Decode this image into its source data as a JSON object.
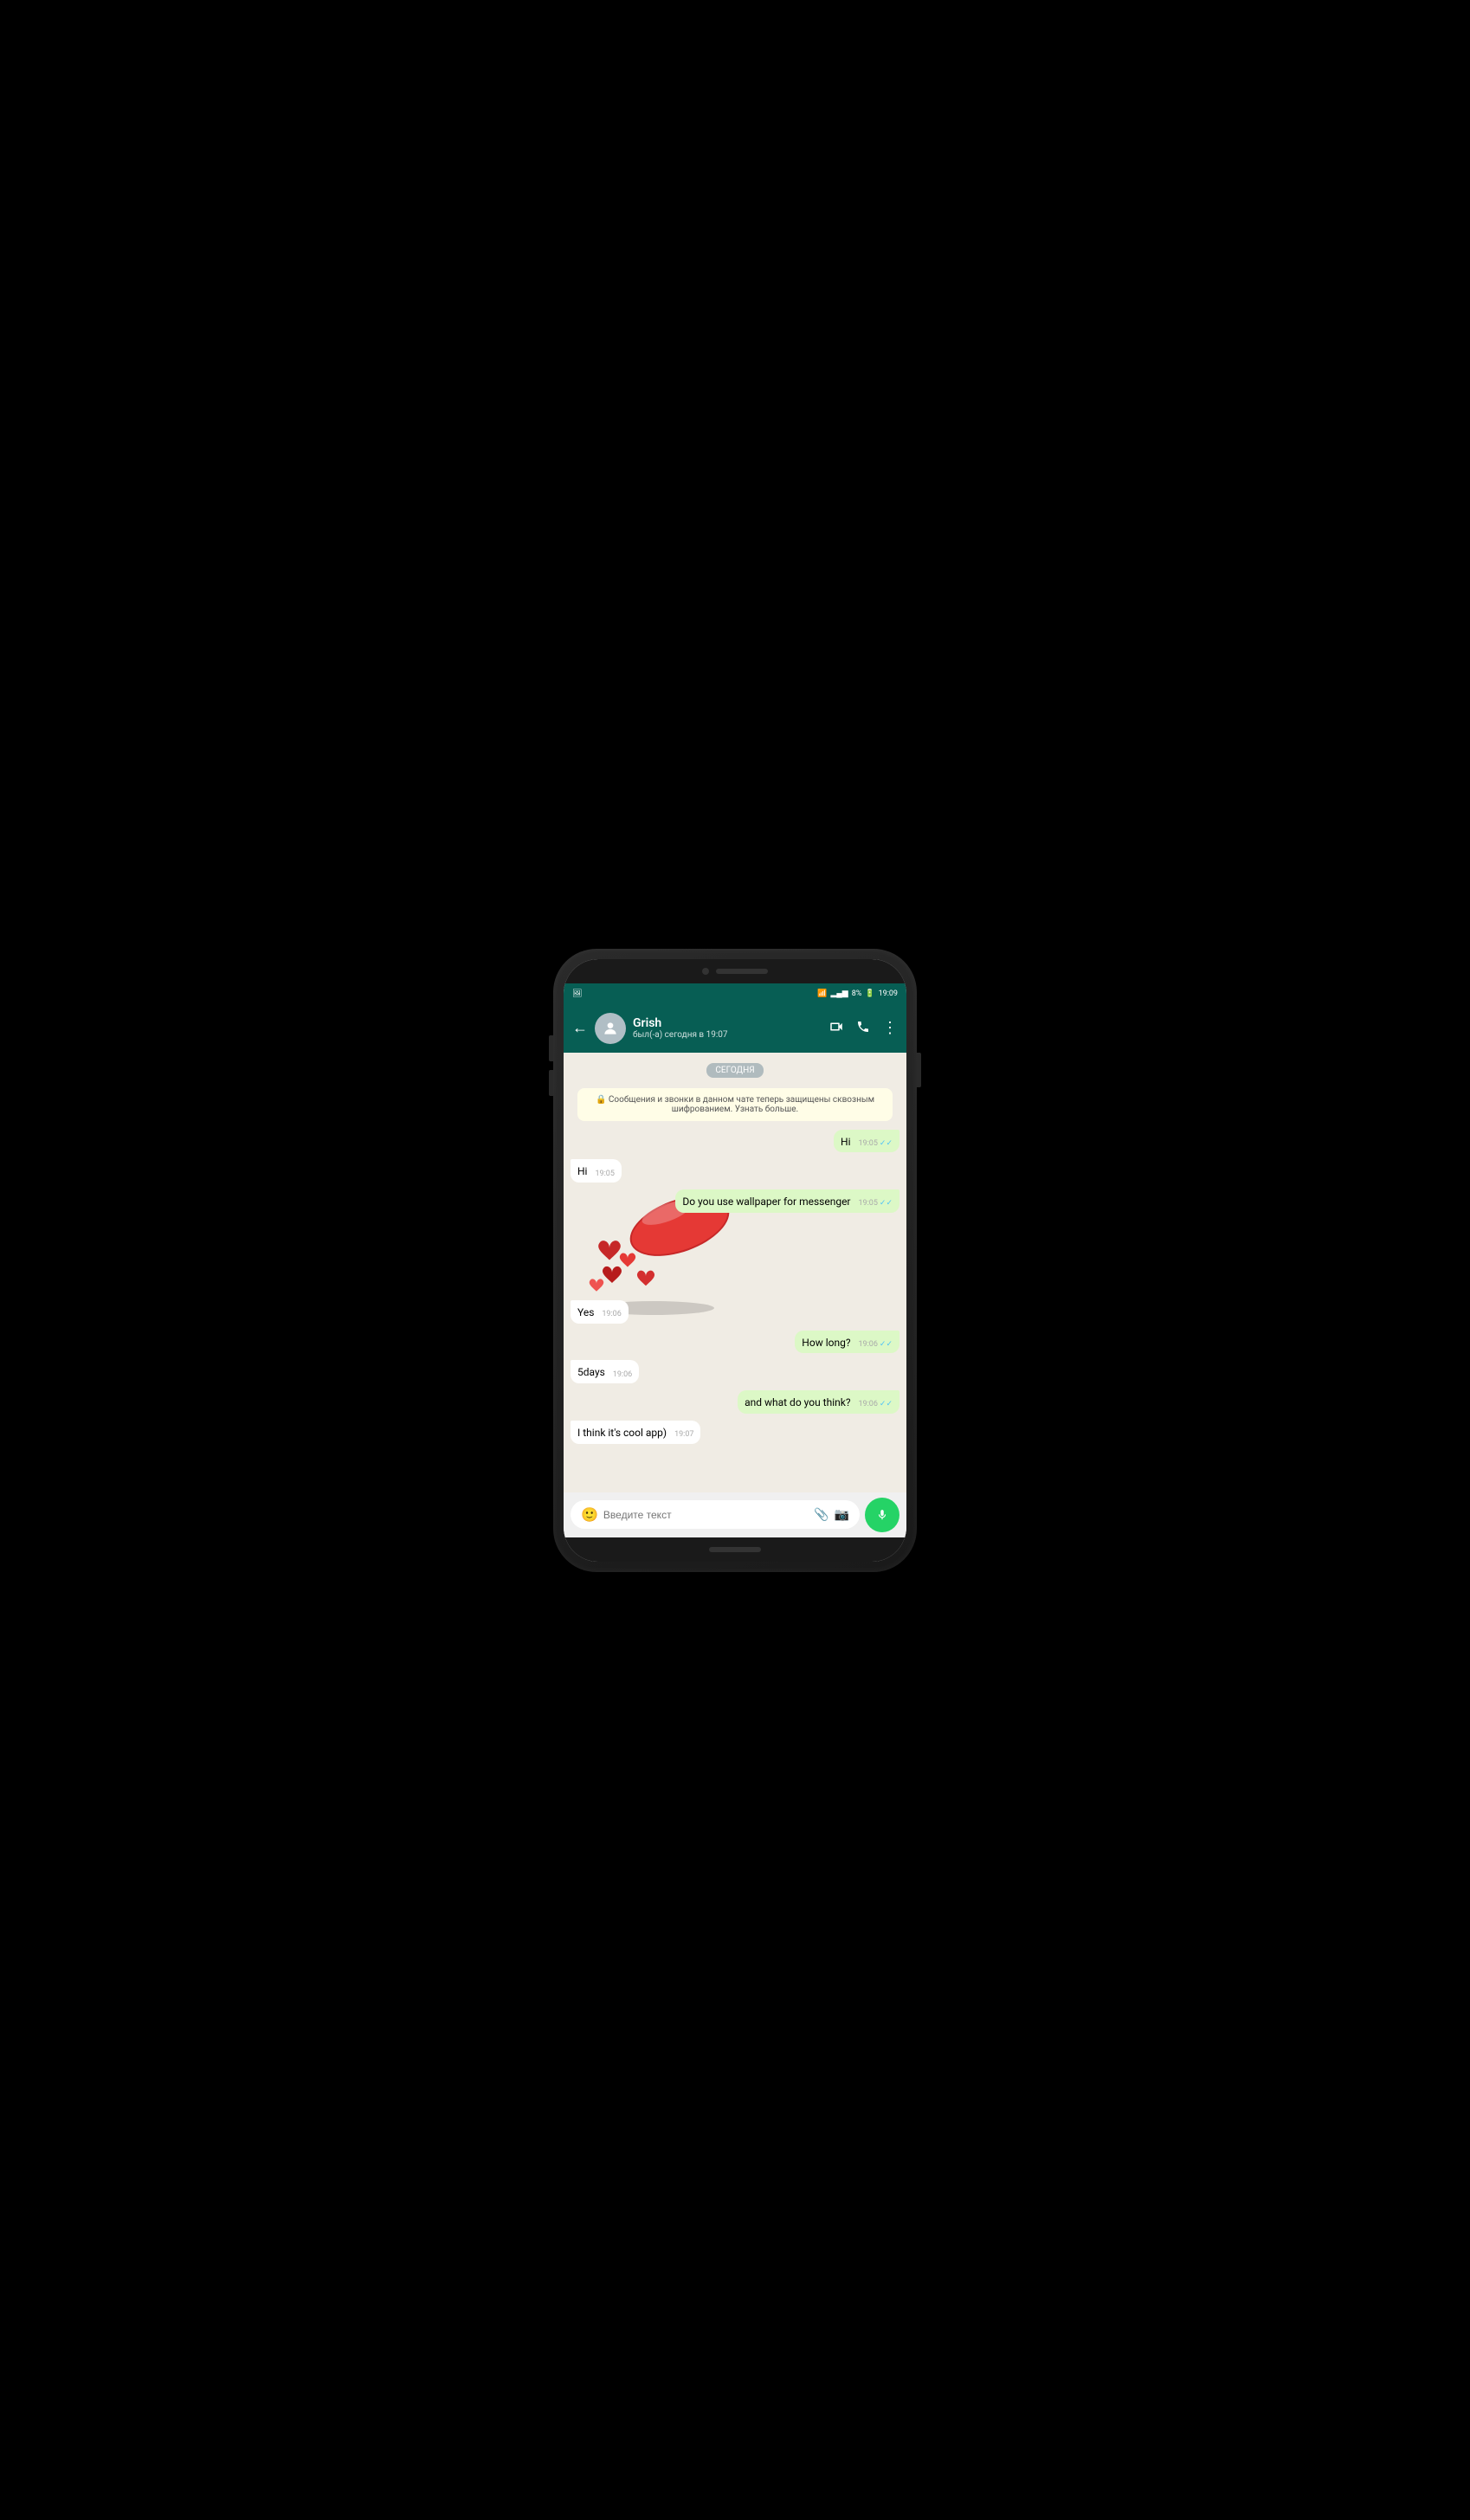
{
  "phone": {
    "status_bar": {
      "left_icon": "🖼",
      "wifi": "wifi-icon",
      "signal": "signal-icon",
      "battery_percent": "8%",
      "battery_icon": "battery-icon",
      "time": "19:09"
    },
    "header": {
      "back_label": "←",
      "contact_name": "Grish",
      "contact_status": "был(-а) сегодня в 19:07",
      "video_icon": "video-call-icon",
      "call_icon": "phone-call-icon",
      "menu_icon": "more-options-icon"
    },
    "chat": {
      "date_badge": "СЕГОДНЯ",
      "encryption_notice": "🔒 Сообщения и звонки в данном чате теперь защищены сквозным шифрованием. Узнать больше.",
      "messages": [
        {
          "id": "msg1",
          "type": "sent",
          "text": "Hi",
          "time": "19:05",
          "read": true
        },
        {
          "id": "msg2",
          "type": "received",
          "text": "Hi",
          "time": "19:05"
        },
        {
          "id": "msg3",
          "type": "sent",
          "text": "Do you use wallpaper for messenger",
          "time": "19:05",
          "read": true
        },
        {
          "id": "msg4",
          "type": "received",
          "text": "Yes",
          "time": "19:06",
          "has_image": true
        },
        {
          "id": "msg5",
          "type": "sent",
          "text": "How long?",
          "time": "19:06",
          "read": true
        },
        {
          "id": "msg6",
          "type": "received",
          "text": "5days",
          "time": "19:06"
        },
        {
          "id": "msg7",
          "type": "sent",
          "text": "and what do you think?",
          "time": "19:06",
          "read": true
        },
        {
          "id": "msg8",
          "type": "received",
          "text": "I think it's cool app)",
          "time": "19:07"
        }
      ]
    },
    "input": {
      "placeholder": "Введите текст",
      "emoji_icon": "emoji-icon",
      "attach_icon": "attach-icon",
      "camera_icon": "camera-icon",
      "mic_icon": "mic-icon"
    }
  }
}
